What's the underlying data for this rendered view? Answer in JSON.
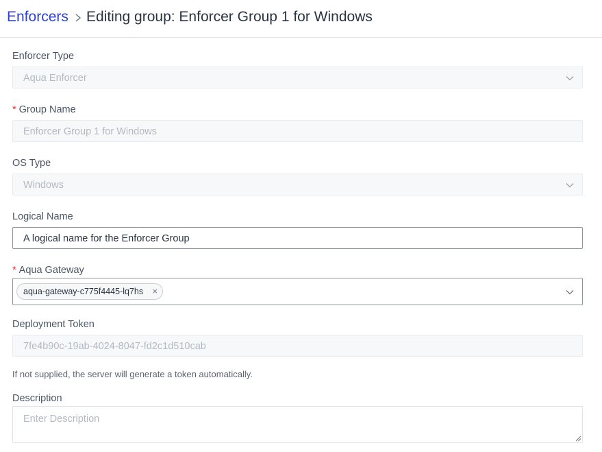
{
  "breadcrumb": {
    "parent": "Enforcers",
    "title": "Editing group: Enforcer Group 1 for Windows"
  },
  "form": {
    "enforcer_type": {
      "label": "Enforcer Type",
      "value": "Aqua Enforcer"
    },
    "group_name": {
      "required_mark": "*",
      "label": "Group Name",
      "value": "Enforcer Group 1 for Windows"
    },
    "os_type": {
      "label": "OS Type",
      "value": "Windows"
    },
    "logical_name": {
      "label": "Logical Name",
      "value": "A logical name for the Enforcer Group"
    },
    "aqua_gateway": {
      "required_mark": "*",
      "label": "Aqua Gateway",
      "tags": [
        "aqua-gateway-c775f4445-lq7hs"
      ],
      "remove_glyph": "×"
    },
    "deployment_token": {
      "label": "Deployment Token",
      "value": "7fe4b90c-19ab-4024-8047-fd2c1d510cab",
      "hint": "If not supplied, the server will generate a token automatically."
    },
    "description": {
      "label": "Description",
      "placeholder": "Enter Description"
    }
  },
  "icons": {
    "breadcrumb_separator": "chevron-right-icon",
    "dropdown": "chevron-down-icon",
    "resize": "resize-handle-icon"
  },
  "colors": {
    "link": "#2f43d1",
    "required": "#e0333a",
    "disabled_bg": "#f7f8fa",
    "disabled_text": "#b2b9c2"
  }
}
